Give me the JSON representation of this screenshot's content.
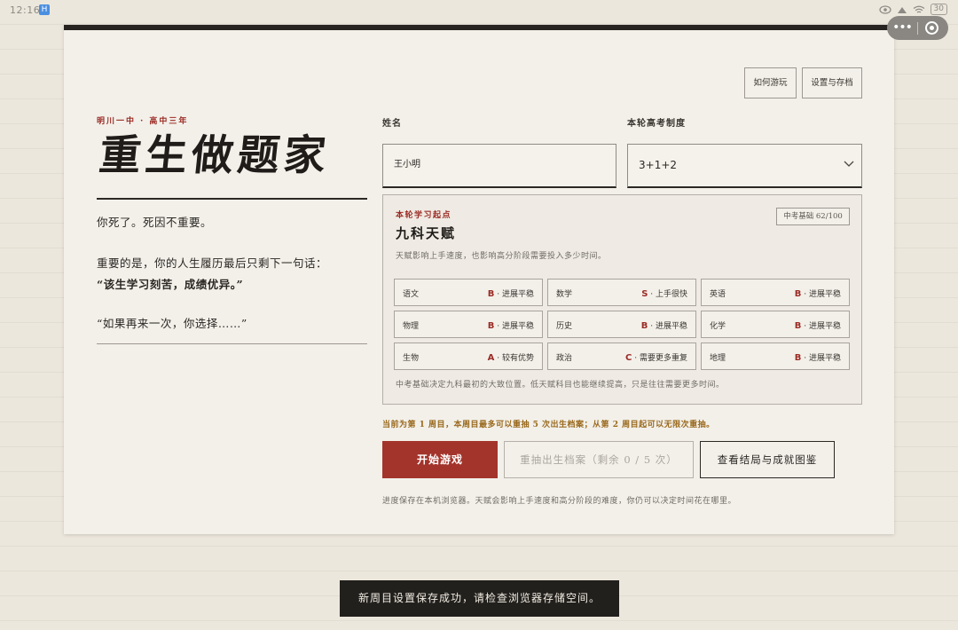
{
  "status_bar": {
    "time": "12:16",
    "app_badge": "H",
    "battery": "30"
  },
  "header": {
    "how_to_play": "如何游玩",
    "settings_save": "设置与存档"
  },
  "intro": {
    "school": "明川一中 · 高中三年",
    "title": "重生做题家",
    "line1": "你死了。死因不重要。",
    "line2": "重要的是，你的人生履历最后只剩下一句话：",
    "line3": "“该生学习刻苦，成绩优异。”",
    "line4": "“如果再来一次，你选择……”"
  },
  "form": {
    "name_label": "姓名",
    "name_value": "王小明",
    "mode_label": "本轮高考制度",
    "mode_value": "3+1+2"
  },
  "talent": {
    "kicker": "本轮学习起点",
    "title": "九科天赋",
    "description": "天赋影响上手速度，也影响高分阶段需要投入多少时间。",
    "badge": "中考基础 62/100",
    "subjects": [
      {
        "name": "语文",
        "grade": "B",
        "desc": "· 进展平稳"
      },
      {
        "name": "数学",
        "grade": "S",
        "desc": "· 上手很快"
      },
      {
        "name": "英语",
        "grade": "B",
        "desc": "· 进展平稳"
      },
      {
        "name": "物理",
        "grade": "B",
        "desc": "· 进展平稳"
      },
      {
        "name": "历史",
        "grade": "B",
        "desc": "· 进展平稳"
      },
      {
        "name": "化学",
        "grade": "B",
        "desc": "· 进展平稳"
      },
      {
        "name": "生物",
        "grade": "A",
        "desc": "· 较有优势"
      },
      {
        "name": "政治",
        "grade": "C",
        "desc": "· 需要更多重复"
      },
      {
        "name": "地理",
        "grade": "B",
        "desc": "· 进展平稳"
      }
    ],
    "note": "中考基础决定九科最初的大致位置。低天赋科目也能继续提高，只是往往需要更多时间。"
  },
  "notice": "当前为第 1 周目，本周目最多可以重抽 5 次出生档案；从第 2 周目起可以无限次重抽。",
  "actions": {
    "start": "开始游戏",
    "reroll": "重抽出生档案（剩余 0 / 5 次）",
    "endings": "查看结局与成就图鉴"
  },
  "footnote": "进度保存在本机浏览器。天赋会影响上手速度和高分阶段的难度，你仍可以决定时间花在哪里。",
  "toast": "新周目设置保存成功，请检查浏览器存储空间。",
  "colors": {
    "accent_red": "#a3342b",
    "ink": "#2b2824",
    "paper": "#f3f0ea",
    "notice_gold": "#9a6a1e"
  },
  "icons": [
    "more-dots-icon",
    "close-target-icon",
    "chevron-down-icon",
    "eye-icon",
    "wifi-icon",
    "battery-icon"
  ]
}
